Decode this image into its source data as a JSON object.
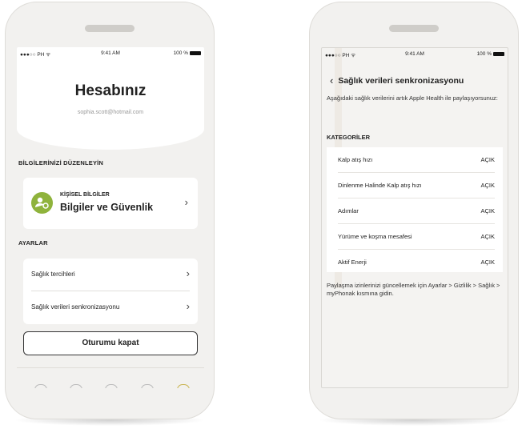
{
  "left_phone": {
    "status": {
      "carrier": "●●●○○ PH ᯤ",
      "time": "9:41 AM",
      "battery": "100 %"
    },
    "title": "Hesabınız",
    "email": "sophia.scott@hotmail.com",
    "edit_section": "BİLGİLERİNİZİ DÜZENLEYİN",
    "profile": {
      "small": "KİŞİSEL BİLGİLER",
      "big": "Bilgiler ve Güvenlik"
    },
    "settings_section": "AYARLAR",
    "settings": [
      {
        "label": "Sağlık tercihleri"
      },
      {
        "label": "Sağlık verileri senkronizasyonu"
      }
    ],
    "logout": "Oturumu kapat"
  },
  "right_phone": {
    "status": {
      "carrier": "●●●○○ PH ᯤ",
      "time": "9:41 AM",
      "battery": "100 %"
    },
    "title": "Sağlık verileri senkronizasyonu",
    "description": "Aşağıdaki sağlık verilerini artık Apple Health ile paylaşıyorsunuz:",
    "categories_header": "KATEGORİLER",
    "categories": [
      {
        "name": "Kalp atış hızı",
        "state": "AÇIK"
      },
      {
        "name": "Dinlenme Halinde Kalp atış hızı",
        "state": "AÇIK"
      },
      {
        "name": "Adımlar",
        "state": "AÇIK"
      },
      {
        "name": "Yürüme ve koşma mesafesi",
        "state": "AÇIK"
      },
      {
        "name": "Aktif Enerji",
        "state": "AÇIK"
      }
    ],
    "footer": "Paylaşma izinlerinizi güncellemek için Ayarlar > Gizlilik > Sağlık > myPhonak kısmına gidin."
  },
  "colors": {
    "accent": "#8fb33c",
    "background": "#f2f1ef",
    "card": "#ffffff"
  },
  "icons": {
    "profile": "user-gear-icon",
    "chevron": "chevron-right-icon",
    "back": "chevron-left-icon"
  }
}
